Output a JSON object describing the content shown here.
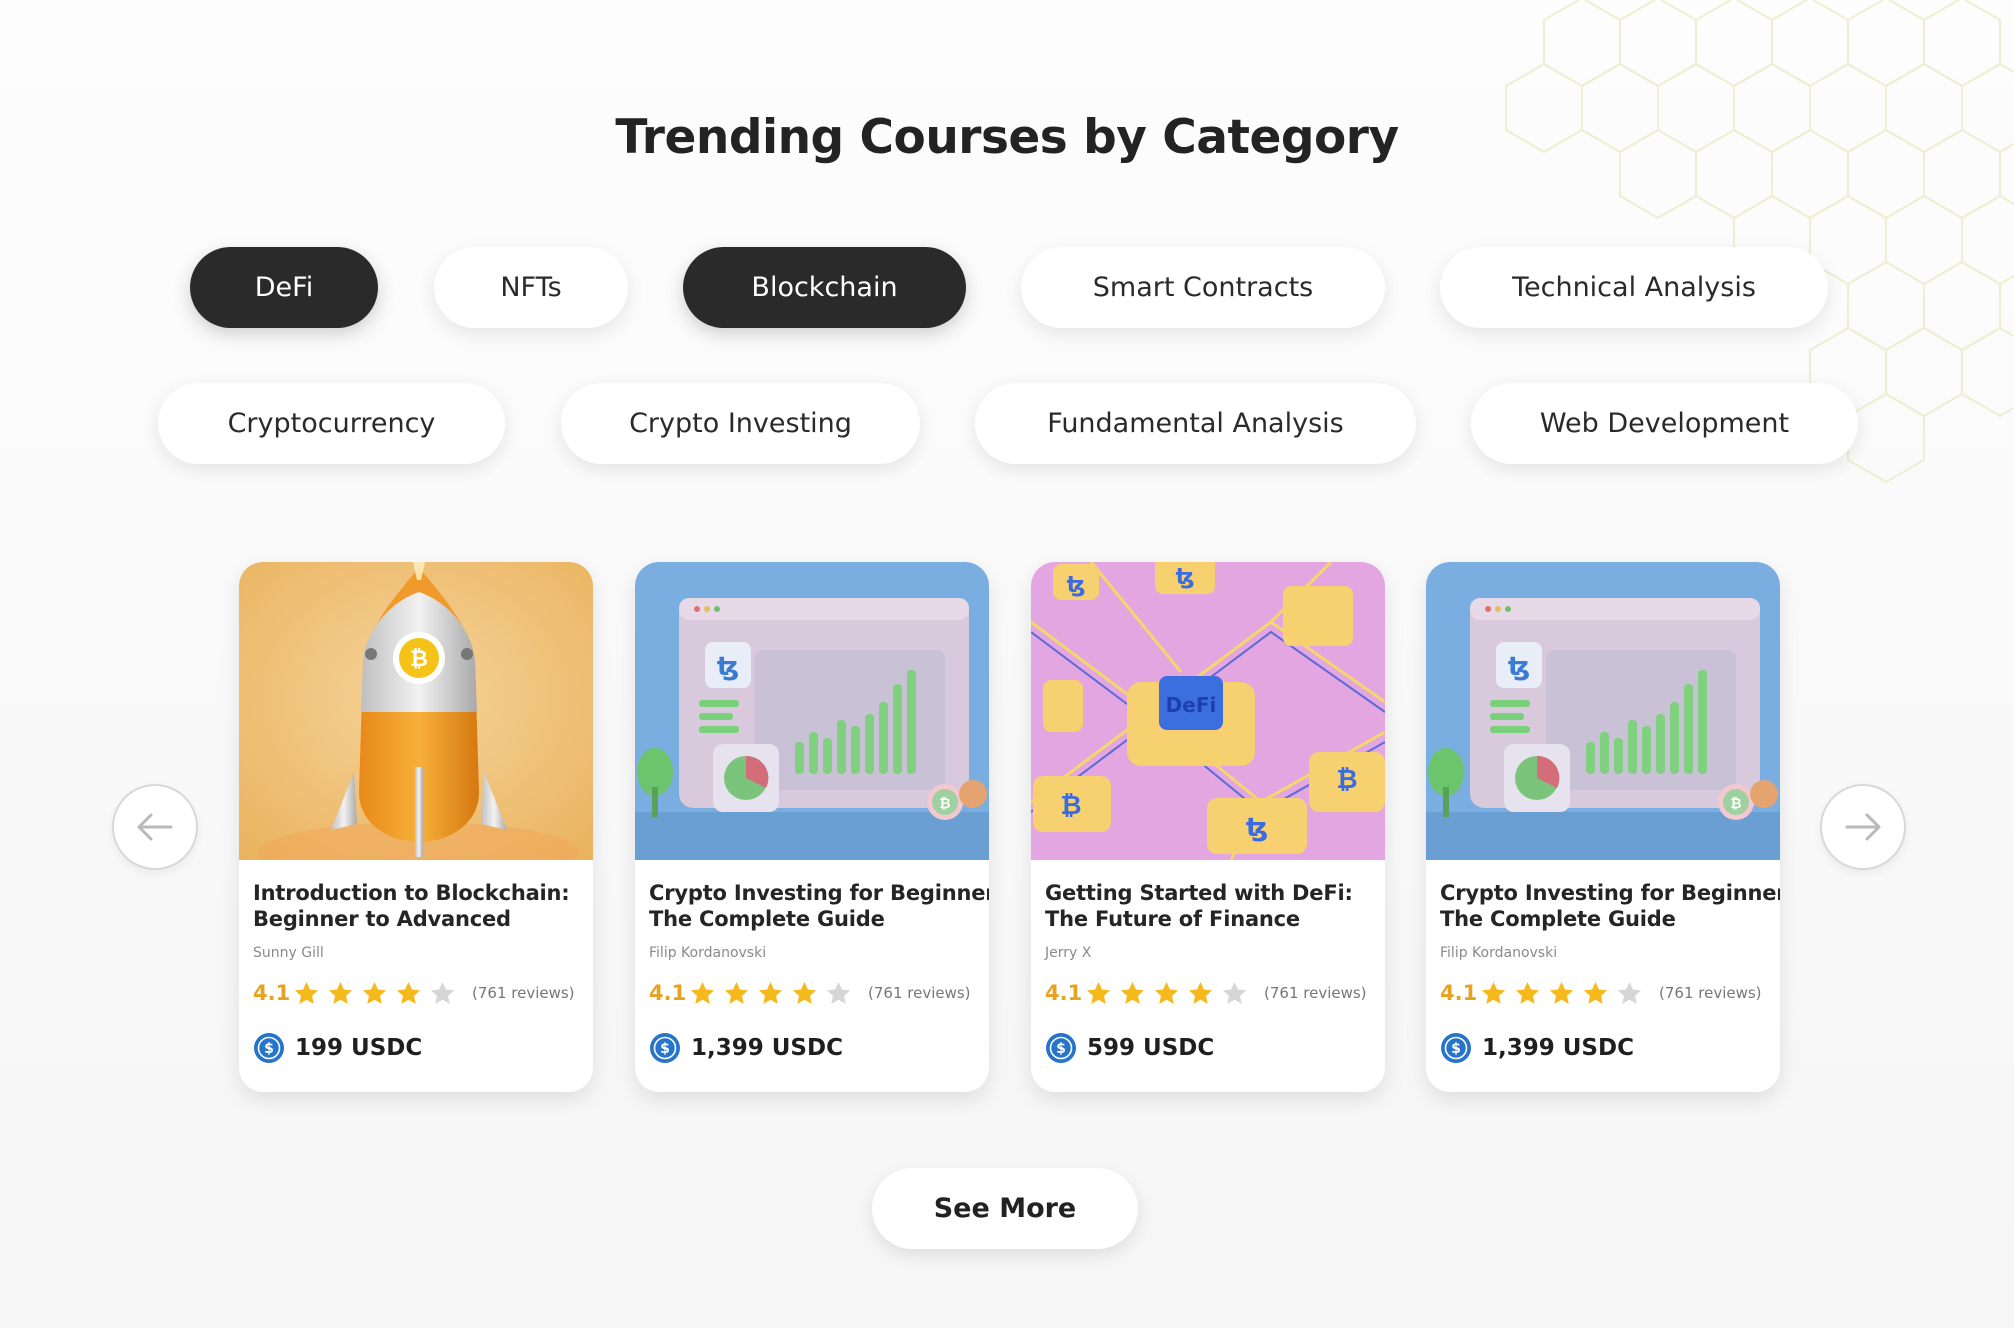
{
  "page_title": "Trending Courses by Category",
  "categories": [
    {
      "label": "DeFi",
      "active": true
    },
    {
      "label": "NFTs",
      "active": false
    },
    {
      "label": "Blockchain",
      "active": true
    },
    {
      "label": "Smart Contracts",
      "active": false
    },
    {
      "label": "Technical Analysis",
      "active": false
    },
    {
      "label": "Cryptocurrency",
      "active": false
    },
    {
      "label": "Crypto Investing",
      "active": false
    },
    {
      "label": "Fundamental Analysis",
      "active": false
    },
    {
      "label": "Web Development",
      "active": false
    }
  ],
  "carousel": {
    "prev_icon": "arrow-left-icon",
    "next_icon": "arrow-right-icon",
    "courses": [
      {
        "title_line1": "Introduction to Blockchain:",
        "title_line2": "Beginner to Advanced",
        "author": "Sunny Gill",
        "rating": "4.1",
        "stars_filled": 4,
        "stars_total": 5,
        "reviews": "(761 reviews)",
        "price": "199 USDC",
        "thumbnail": "rocket-bitcoin-illustration"
      },
      {
        "title_line1": "Crypto Investing for Beginners:",
        "title_line2": "The Complete Guide",
        "author": "Filip Kordanovski",
        "rating": "4.1",
        "stars_filled": 4,
        "stars_total": 5,
        "reviews": "(761 reviews)",
        "price": "1,399 USDC",
        "thumbnail": "dashboard-chart-illustration"
      },
      {
        "title_line1": "Getting Started with DeFi:",
        "title_line2": "The Future of Finance",
        "author": "Jerry X",
        "rating": "4.1",
        "stars_filled": 4,
        "stars_total": 5,
        "reviews": "(761 reviews)",
        "price": "599 USDC",
        "thumbnail": "defi-network-illustration"
      },
      {
        "title_line1": "Crypto Investing for Beginners:",
        "title_line2": "The Complete Guide",
        "author": "Filip Kordanovski",
        "rating": "4.1",
        "stars_filled": 4,
        "stars_total": 5,
        "reviews": "(761 reviews)",
        "price": "1,399 USDC",
        "thumbnail": "dashboard-chart-illustration"
      }
    ]
  },
  "see_more_label": "See More",
  "colors": {
    "accent_dark": "#2a2a2a",
    "rating": "#e6a321",
    "star_filled": "#f5b91c",
    "star_empty": "#d6d6d6",
    "usdc_blue": "#2775ca"
  }
}
